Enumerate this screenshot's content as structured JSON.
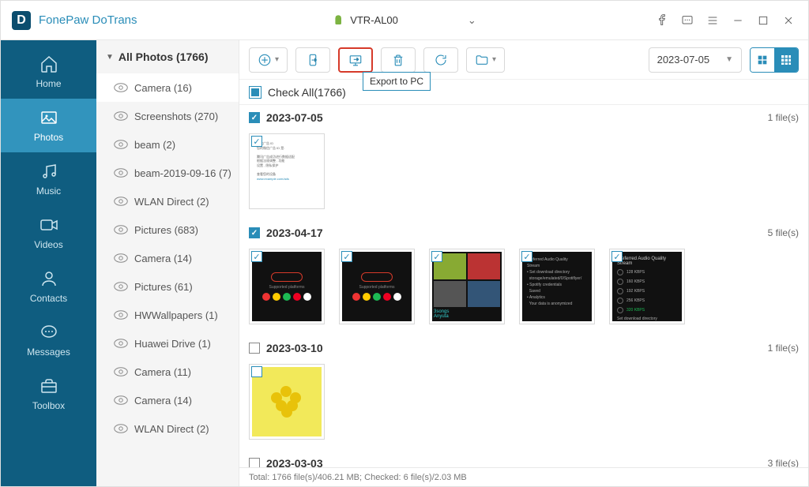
{
  "app": {
    "title": "FonePaw DoTrans",
    "device": "VTR-AL00"
  },
  "nav": [
    {
      "id": "home",
      "label": "Home"
    },
    {
      "id": "photos",
      "label": "Photos"
    },
    {
      "id": "music",
      "label": "Music"
    },
    {
      "id": "videos",
      "label": "Videos"
    },
    {
      "id": "contacts",
      "label": "Contacts"
    },
    {
      "id": "messages",
      "label": "Messages"
    },
    {
      "id": "toolbox",
      "label": "Toolbox"
    }
  ],
  "albums": {
    "header": "All Photos (1766)",
    "items": [
      "Camera (16)",
      "Screenshots (270)",
      "beam (2)",
      "beam-2019-09-16 (7)",
      "WLAN Direct (2)",
      "Pictures (683)",
      "Camera (14)",
      "Pictures (61)",
      "HWWallpapers (1)",
      "Huawei Drive (1)",
      "Camera (11)",
      "Camera (14)",
      "WLAN Direct (2)"
    ]
  },
  "toolbar": {
    "tooltip": "Export to PC",
    "date": "2023-07-05"
  },
  "checkall": "Check All(1766)",
  "groups": [
    {
      "date": "2023-07-05",
      "checked": true,
      "files": "1 file(s)",
      "thumbs": [
        "doc"
      ]
    },
    {
      "date": "2023-04-17",
      "checked": true,
      "files": "5 file(s)",
      "thumbs": [
        "dark",
        "dark",
        "albums",
        "settings",
        "radio"
      ]
    },
    {
      "date": "2023-03-10",
      "checked": false,
      "files": "1 file(s)",
      "thumbs": [
        "flowers"
      ]
    },
    {
      "date": "2023-03-03",
      "checked": false,
      "files": "3 file(s)",
      "thumbs": []
    }
  ],
  "status": "Total: 1766 file(s)/406.21 MB; Checked: 6 file(s)/2.03 MB"
}
